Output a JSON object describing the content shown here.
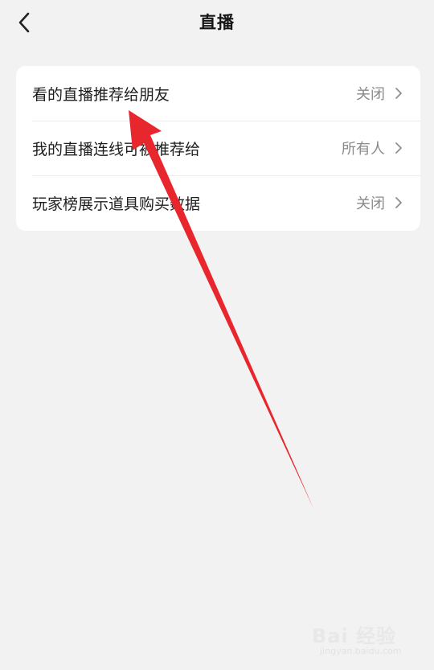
{
  "header": {
    "title": "直播",
    "back_icon": "chevron-left-icon"
  },
  "settings": [
    {
      "label": "看的直播推荐给朋友",
      "value": "关闭"
    },
    {
      "label": "我的直播连线可被推荐给",
      "value": "所有人"
    },
    {
      "label": "玩家榜展示道具购买数据",
      "value": "关闭"
    }
  ],
  "annotation": {
    "type": "red-arrow",
    "color": "#e8262d"
  },
  "watermark": {
    "logo": "Bai 经验",
    "url": "jingyan.baidu.com"
  }
}
